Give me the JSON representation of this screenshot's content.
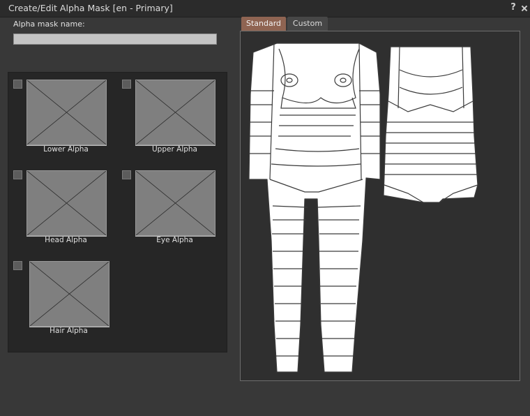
{
  "window": {
    "title": "Create/Edit Alpha Mask [en - Primary]",
    "help_label": "?",
    "close_icon": "close-icon"
  },
  "form": {
    "name_label": "Alpha mask name:",
    "name_value": "",
    "name_placeholder": ""
  },
  "slots": [
    {
      "label": "Lower Alpha",
      "checked": false
    },
    {
      "label": "Upper Alpha",
      "checked": false
    },
    {
      "label": "Head Alpha",
      "checked": false
    },
    {
      "label": "Eye Alpha",
      "checked": false
    },
    {
      "label": "Hair Alpha",
      "checked": false
    }
  ],
  "tabs": [
    {
      "label": "Standard",
      "active": true
    },
    {
      "label": "Custom",
      "active": false
    }
  ],
  "colors": {
    "background": "#383838",
    "panel": "#262626",
    "active_tab": "#8f6452",
    "thumbnail": "#7f7f7f",
    "body_fill": "#ffffff"
  }
}
